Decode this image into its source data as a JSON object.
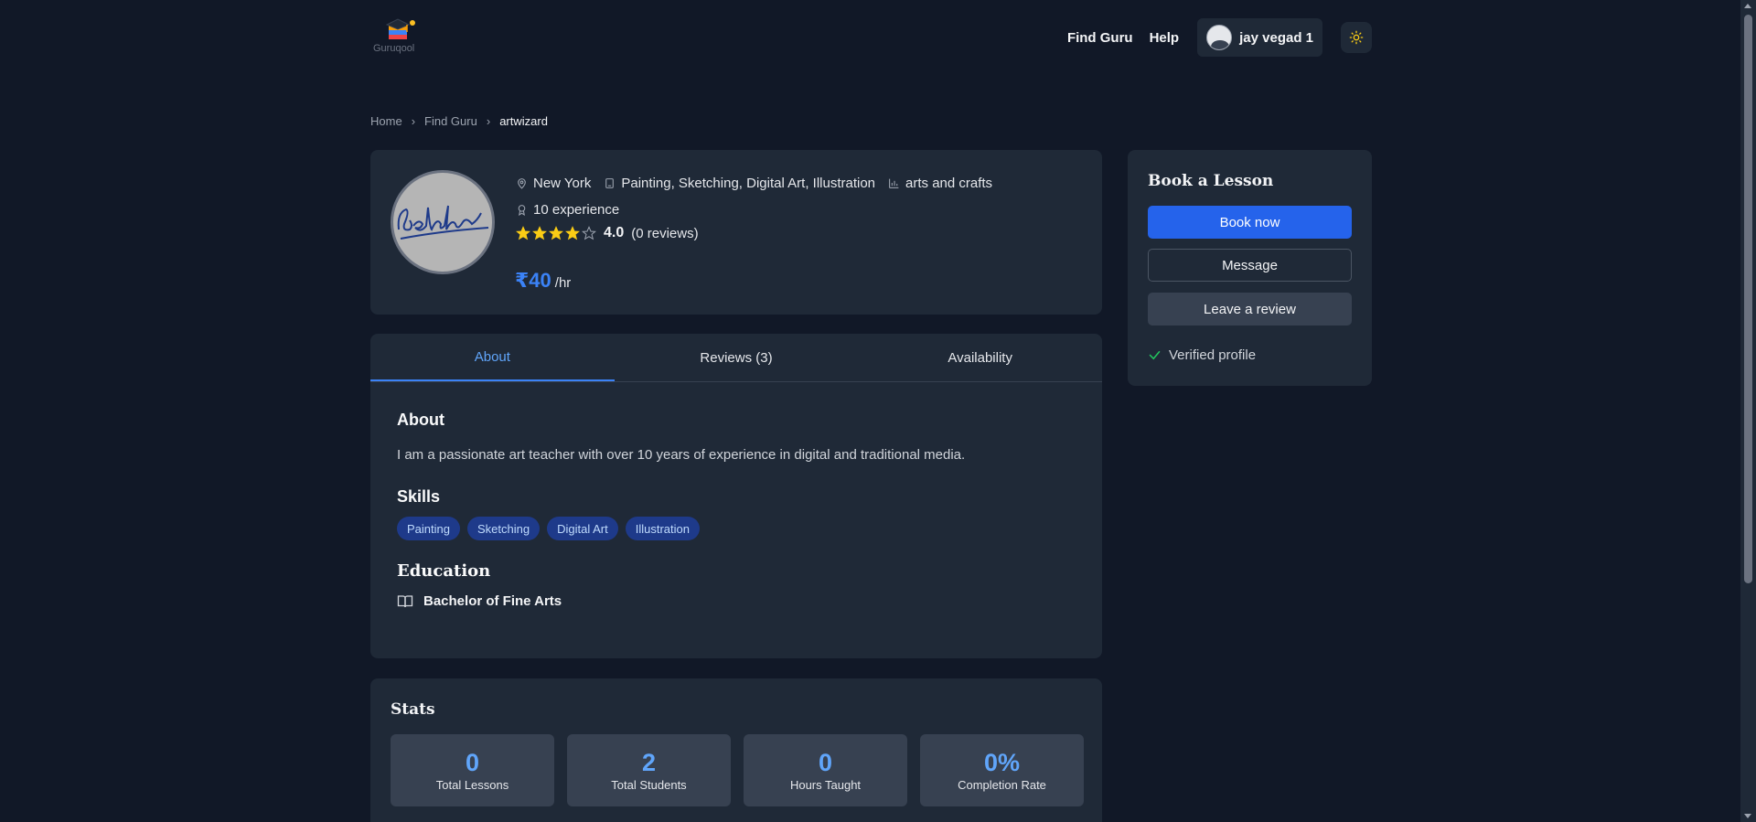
{
  "app": {
    "logo_text": "Guruqool",
    "colors": {
      "background": "#111827",
      "card": "#1f2937",
      "accent": "#3b82f6",
      "star": "#facc15",
      "verified": "#22c55e"
    }
  },
  "nav": {
    "find_guru": "Find Guru",
    "help": "Help",
    "user_name": "jay vegad 1",
    "theme_icon": "sun-icon"
  },
  "breadcrumb": {
    "home": "Home",
    "find_guru": "Find Guru",
    "current": "artwizard"
  },
  "profile": {
    "location": "New York",
    "subjects": "Painting, Sketching, Digital Art, Illustration",
    "category": "arts and crafts",
    "experience": "10 experience",
    "rating_value": 4,
    "rating_max": 5,
    "rating_text": "4.0",
    "reviews_text": "(0 reviews)",
    "price": "₹40",
    "price_unit": "/hr",
    "avatar_signature": "Beldhoy"
  },
  "booking": {
    "title": "Book a Lesson",
    "book_now": "Book now",
    "message": "Message",
    "leave_review": "Leave a review",
    "verified": "Verified profile"
  },
  "tabs": [
    {
      "label": "About",
      "active": true
    },
    {
      "label": "Reviews (3)",
      "active": false
    },
    {
      "label": "Availability",
      "active": false
    }
  ],
  "about": {
    "heading": "About",
    "text": "I am a passionate art teacher with over 10 years of experience in digital and traditional media.",
    "skills_heading": "Skills",
    "skills": [
      "Painting",
      "Sketching",
      "Digital Art",
      "Illustration"
    ],
    "education_heading": "Education",
    "education": "Bachelor of Fine Arts"
  },
  "stats": {
    "title": "Stats",
    "items": [
      {
        "value": "0",
        "label": "Total Lessons"
      },
      {
        "value": "2",
        "label": "Total Students"
      },
      {
        "value": "0",
        "label": "Hours Taught"
      },
      {
        "value": "0%",
        "label": "Completion Rate"
      }
    ]
  }
}
